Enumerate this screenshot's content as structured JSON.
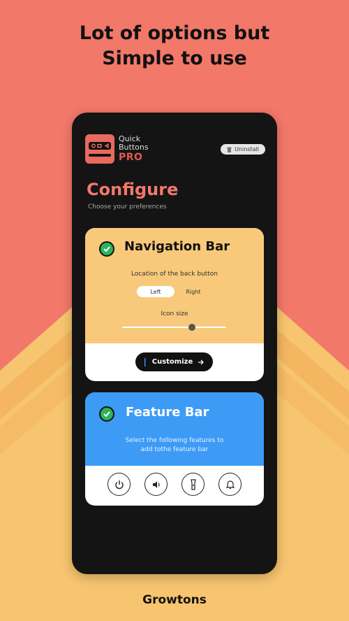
{
  "headline": {
    "line1": "Lot of options but",
    "line2": "Simple to use"
  },
  "footer": {
    "brand": "Growtons"
  },
  "app": {
    "logo_line1": "Quick",
    "logo_line2": "Buttons",
    "logo_pro": "PRO",
    "uninstall_label": "Uninstall",
    "configure_title": "Configure",
    "configure_subtitle": "Choose your preferences"
  },
  "navigation_card": {
    "title": "Navigation Bar",
    "enabled": true,
    "location_label": "Location of the back button",
    "options": [
      "Left",
      "Right"
    ],
    "selected_option": "Left",
    "icon_size_label": "Icon size",
    "icon_size_value": 0.67,
    "customize_label": "Customize"
  },
  "feature_card": {
    "title": "Feature Bar",
    "enabled": true,
    "description_line1": "Select the following features to",
    "description_line2": "add tothe feature bar",
    "features": [
      "power-icon",
      "volume-icon",
      "flashlight-icon",
      "bell-icon"
    ]
  },
  "colors": {
    "background_top": "#F2786A",
    "background_chevron": "#F7C46F",
    "phone": "#141414",
    "accent": "#F2786A",
    "nav_card": "#F8C97A",
    "feature_card": "#3D9BF6",
    "check": "#2db35d"
  }
}
